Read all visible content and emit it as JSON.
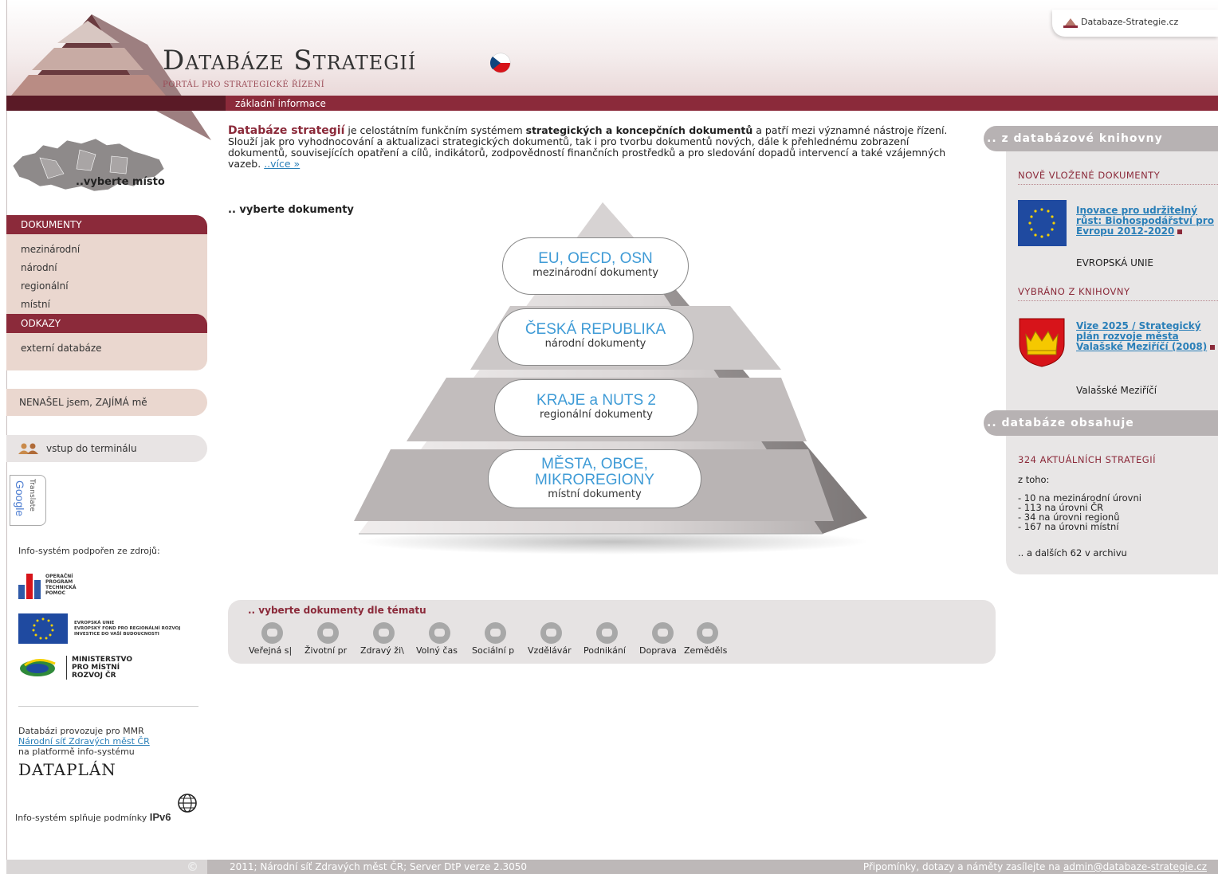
{
  "header": {
    "badge_text": "Databaze-Strategie.cz",
    "title": "Databáze Strategií",
    "subtitle": "PORTÁL PRO STRATEGICKÉ ŘÍZENÍ",
    "section": "základní informace"
  },
  "sidebar": {
    "map_label": "..vyberte místo",
    "documents_heading": "DOKUMENTY",
    "documents": [
      "mezinárodní",
      "národní",
      "regionální",
      "místní"
    ],
    "links_heading": "ODKAZY",
    "links": [
      "externí databáze"
    ],
    "found_button": "NENAŠEL jsem, ZAJÍMÁ mě",
    "terminal_button": "vstup do terminálu",
    "google_translate": "Google",
    "google_translate_sub": "Translate",
    "support_label": "Info-systém podpořen ze zdrojů:",
    "sponsor1": "OPERAČNÍ PROGRAM TECHNICKÁ POMOC",
    "sponsor2a": "EVROPSKÁ UNIE",
    "sponsor2b": "EVROPSKÝ FOND PRO REGIONÁLNÍ ROZVOJ",
    "sponsor2c": "INVESTICE DO VAŠÍ BUDOUCNOSTI",
    "sponsor3": "MINISTERSTVO PRO MÍSTNÍ ROZVOJ ČR",
    "operator_line1": "Databázi provozuje pro MMR",
    "operator_link": "Národní síť Zdravých měst ČR",
    "operator_line2": "na platformě info-systému",
    "dataplan": "DATAPLÁN",
    "ipv6_text": "Info-systém splňuje podmínky",
    "ipv6_badge": "IPv6"
  },
  "main": {
    "intro_brand": "Databáze strategií",
    "intro_p1": " je celostátním funkčním systémem ",
    "intro_bold": "strategických a koncepčních dokumentů",
    "intro_p2": " a patří mezi významné nástroje řízení. Slouží jak pro vyhodnocování a aktualizaci strategických dokumentů, tak i pro tvorbu dokumentů nových, dále k přehlednému zobrazení dokumentů, souvisejících opatření a cílů, indikátorů, zodpovědností finančních prostředků a pro sledování dopadů intervencí a také vzájemných vazeb. ",
    "intro_more": "..více »",
    "choose_docs": ".. vyberte dokumenty",
    "pyramid": [
      {
        "big": "EU, OECD, OSN",
        "small": "mezinárodní dokumenty"
      },
      {
        "big": "ČESKÁ REPUBLIKA",
        "small": "národní dokumenty"
      },
      {
        "big": "KRAJE a NUTS 2",
        "small": "regionální dokumenty"
      },
      {
        "big": "MĚSTA, OBCE, MIKROREGIONY",
        "small": "místní dokumenty"
      }
    ],
    "topics_title": ".. vyberte dokumenty dle tématu",
    "topics": [
      "Veřejná s|",
      "Životní pr",
      "Zdravý ži\\",
      "Volný čas",
      "Sociální p",
      "Vzdělávár",
      "Podnikání",
      "Doprava",
      "Zeměděls"
    ]
  },
  "right": {
    "library_heading": ".. z databázové knihovny",
    "new_docs": "NOVĚ VLOŽENÉ DOKUMENTY",
    "new_doc_title": "Inovace pro udržitelný růst: Biohospodářství pro Evropu 2012-2020",
    "new_doc_source": "EVROPSKÁ UNIE",
    "picked": "VYBRÁNO Z KNIHOVNY",
    "picked_title": "Vize 2025 / Strategický plán rozvoje města Valašské Meziříčí (2008)",
    "picked_source": "Valašské Meziříčí",
    "contains_heading": ".. databáze obsahuje",
    "count": "324 AKTUÁLNÍCH STRATEGIÍ",
    "of_which": "z toho:",
    "stats": [
      "- 10 na mezinárodní úrovni",
      "- 113 na úrovni ČR",
      "- 34 na úrovni regionů",
      "- 167 na úrovni místní"
    ],
    "archive": ".. a dalších 62 v archivu"
  },
  "footer": {
    "copyright": "©",
    "left": "2011; Národní síť Zdravých měst ČR; Server DtP verze 2.3050",
    "right_text": "Připomínky, dotazy a náměty zasílejte na ",
    "email": "admin@databaze-strategie.cz"
  },
  "colors": {
    "brand": "#8b2a3a",
    "link": "#2a7fb8",
    "pyramid_text": "#3f9bd6"
  }
}
